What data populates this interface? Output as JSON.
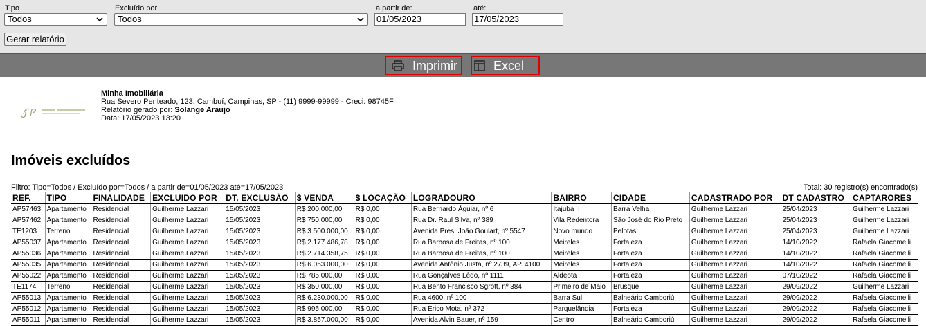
{
  "filters": {
    "tipo": {
      "label": "Tipo",
      "value": "Todos"
    },
    "excluido_por": {
      "label": "Excluído por",
      "value": "Todos"
    },
    "date_from": {
      "label": "a partir de:",
      "value": "01/05/2023"
    },
    "date_to": {
      "label": "até:",
      "value": "17/05/2023"
    },
    "generate_label": "Gerar relatório"
  },
  "toolbar": {
    "print_label": "Imprimir",
    "excel_label": "Excel"
  },
  "header": {
    "company_name": "Minha Imobiliária",
    "address": "Rua Severo Penteado, 123, Cambuí, Campinas, SP - (11) 9999-99999 - Creci: 98745F",
    "generated_by_label": "Relatório gerado por: ",
    "generated_by": "Solange Araujo",
    "date": "Data: 17/05/2023 13:20"
  },
  "report": {
    "title": "Imóveis excluídos",
    "filter_text": "Filtro: Tipo=Todos / Excluído por=Todos / a partir de=01/05/2023 até=17/05/2023",
    "total_text": "Total: 30 registro(s) encontrado(s)",
    "columns": [
      "REF.",
      "TIPO",
      "FINALIDADE",
      "EXCLUIDO POR",
      "DT. EXCLUSÃO",
      "$ VENDA",
      "$ LOCAÇÃO",
      "LOGRADOURO",
      "BAIRRO",
      "CIDADE",
      "CADASTRADO POR",
      "DT CADASTRO",
      "CAPTARORES"
    ],
    "rows": [
      [
        "AP57463",
        "Apartamento",
        "Residencial",
        "Guilherme Lazzari",
        "15/05/2023",
        "R$ 200.000,00",
        "R$ 0,00",
        "Rua Bernardo Águiar, nº 6",
        "Itajubá II",
        "Barra Velha",
        "Guilherme Lazzari",
        "25/04/2023",
        "Guilherme Lazzari"
      ],
      [
        "AP57462",
        "Apartamento",
        "Residencial",
        "Guilherme Lazzari",
        "15/05/2023",
        "R$ 750.000,00",
        "R$ 0,00",
        "Rua Dr. Raul Silva, nº 389",
        "Vila Redentora",
        "São José do Rio Preto",
        "Guilherme Lazzari",
        "25/04/2023",
        "Guilherme Lazzari"
      ],
      [
        "TE1203",
        "Terreno",
        "Residencial",
        "Guilherme Lazzari",
        "15/05/2023",
        "R$ 3.500.000,00",
        "R$ 0,00",
        "Avenida Pres. João Goulart, nº 5547",
        "Novo mundo",
        "Pelotas",
        "Guilherme Lazzari",
        "25/04/2023",
        "Guilherme Lazzari"
      ],
      [
        "AP55037",
        "Apartamento",
        "Residencial",
        "Guilherme Lazzari",
        "15/05/2023",
        "R$ 2.177.486,78",
        "R$ 0,00",
        "Rua Barbosa de Freitas, nº 100",
        "Meireles",
        "Fortaleza",
        "Guilherme Lazzari",
        "14/10/2022",
        "Rafaela Giacomelli"
      ],
      [
        "AP55036",
        "Apartamento",
        "Residencial",
        "Guilherme Lazzari",
        "15/05/2023",
        "R$ 2.714.358,75",
        "R$ 0,00",
        "Rua Barbosa de Freitas, nº 100",
        "Meireles",
        "Fortaleza",
        "Guilherme Lazzari",
        "14/10/2022",
        "Rafaela Giacomelli"
      ],
      [
        "AP55035",
        "Apartamento",
        "Residencial",
        "Guilherme Lazzari",
        "15/05/2023",
        "R$ 6.053.000,00",
        "R$ 0,00",
        "Avenida Antônio Justa, nº 2739, AP. 4100",
        "Meireles",
        "Fortaleza",
        "Guilherme Lazzari",
        "14/10/2022",
        "Rafaela Giacomelli"
      ],
      [
        "AP55022",
        "Apartamento",
        "Residencial",
        "Guilherme Lazzari",
        "15/05/2023",
        "R$ 785.000,00",
        "R$ 0,00",
        "Rua Gonçalves Lêdo, nº 1111",
        "Aldeota",
        "Fortaleza",
        "Guilherme Lazzari",
        "07/10/2022",
        "Rafaela Giacomelli"
      ],
      [
        "TE1174",
        "Terreno",
        "Residencial",
        "Guilherme Lazzari",
        "15/05/2023",
        "R$ 350.000,00",
        "R$ 0,00",
        "Rua Bento Francisco Sgrott, nº 384",
        "Primeiro de Maio",
        "Brusque",
        "Guilherme Lazzari",
        "29/09/2022",
        "Guilherme Lazzari"
      ],
      [
        "AP55013",
        "Apartamento",
        "Residencial",
        "Guilherme Lazzari",
        "15/05/2023",
        "R$ 6.230.000,00",
        "R$ 0,00",
        "Rua 4600, nº 100",
        "Barra Sul",
        "Balneário Camboriú",
        "Guilherme Lazzari",
        "29/09/2022",
        "Rafaela Giacomelli"
      ],
      [
        "AP55012",
        "Apartamento",
        "Residencial",
        "Guilherme Lazzari",
        "15/05/2023",
        "R$ 995.000,00",
        "R$ 0,00",
        "Rua Érico Mota, nº 372",
        "Parquelândia",
        "Fortaleza",
        "Guilherme Lazzari",
        "29/09/2022",
        "Rafaela Giacomelli"
      ],
      [
        "AP55011",
        "Apartamento",
        "Residencial",
        "Guilherme Lazzari",
        "15/05/2023",
        "R$ 3.857.000,00",
        "R$ 0,00",
        "Avenida Alvin Bauer, nº 159",
        "Centro",
        "Balneário Camboriú",
        "Guilherme Lazzari",
        "29/09/2022",
        "Rafaela Giacomelli"
      ]
    ]
  }
}
